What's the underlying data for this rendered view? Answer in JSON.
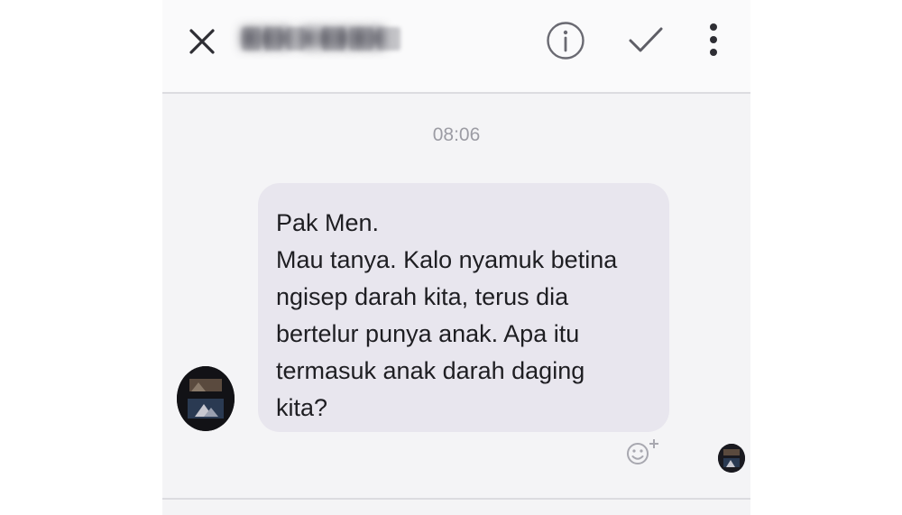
{
  "header": {
    "contact_name": "▇▇▇ ▇▇▇▇▇",
    "icons": {
      "close": "close-icon",
      "info": "info-icon",
      "check": "check-icon",
      "more": "more-vertical-icon"
    }
  },
  "conversation": {
    "timestamp": "08:06",
    "message": {
      "lines": [
        "Pak Men.",
        "Mau tanya. Kalo nyamuk betina",
        "ngisep darah kita, terus dia",
        "bertelur punya anak. Apa itu",
        "termasuk anak darah daging",
        "kita?"
      ]
    },
    "icons": {
      "sender_avatar": "avatar",
      "add_reaction": "add-reaction-icon",
      "read_receipt_avatar": "avatar"
    }
  },
  "colors": {
    "background": "#f4f4f6",
    "bubble": "#e8e6ee",
    "icon": "#3a3a40",
    "timestamp": "#9c9ca4"
  }
}
